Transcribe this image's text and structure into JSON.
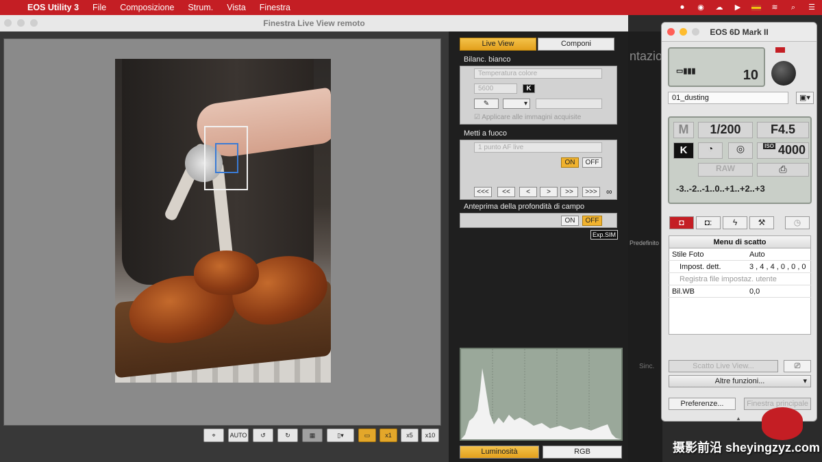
{
  "menubar": {
    "app": "EOS Utility 3",
    "items": [
      "File",
      "Composizione",
      "Strum.",
      "Vista",
      "Finestra"
    ]
  },
  "liveview": {
    "title": "Finestra Live View remoto",
    "tabs": [
      "Live View",
      "Componi"
    ],
    "wb_section": "Bilanc. bianco",
    "wb_select": "Temperatura colore",
    "wb_value": "5600",
    "wb_unit": "K",
    "apply_label": "Applicare alle immagini acquisite",
    "focus_section": "Metti a fuoco",
    "focus_select": "1 punto AF live",
    "on_label": "ON",
    "off_label": "OFF",
    "dof_section": "Anteprima della profondità di campo",
    "exp_sim": "Exp.SIM",
    "nav_buttons": [
      "<<<",
      "<<",
      "<",
      ">",
      ">>",
      ">>>",
      "∞"
    ],
    "histogram_buttons": [
      "Luminosità",
      "RGB"
    ],
    "toolbar": [
      "⌖",
      "AUTO",
      "↺",
      "↻",
      "▦",
      "▯▾",
      "▭",
      "x1",
      "x5",
      "x10"
    ]
  },
  "bg_window": {
    "partial_title": "ntazio",
    "predefinito": "Predefinito",
    "sinc": "Sinc."
  },
  "camera": {
    "title": "EOS 6D Mark II",
    "battery_count": "10",
    "folder": "01_dusting",
    "mode": "M",
    "shutter": "1/200",
    "aperture": "F4.5",
    "wb_mode": "K",
    "iso_label": "ISO",
    "iso": "4000",
    "quality": "RAW",
    "exposure_scale": "-3..-2..-1..0..+1..+2..+3",
    "menu_title": "Menu di scatto",
    "menu_rows": [
      {
        "label": "Stile Foto",
        "value": "Auto"
      },
      {
        "label": "Impost. dett.",
        "value": "3 , 4 , 4 , 0 , 0 , 0"
      },
      {
        "label": "Registra file impostaz. utente",
        "value": ""
      },
      {
        "label": "Bil.WB",
        "value": "0,0"
      }
    ],
    "liveview_shot": "Scatto Live View...",
    "other_functions": "Altre funzioni...",
    "preferences": "Preferenze...",
    "main_window": "Finestra principale"
  },
  "watermark": "摄影前沿 sheyingzyz.com",
  "colors": {
    "accent": "#e3a01c",
    "brand": "#c41e24"
  }
}
